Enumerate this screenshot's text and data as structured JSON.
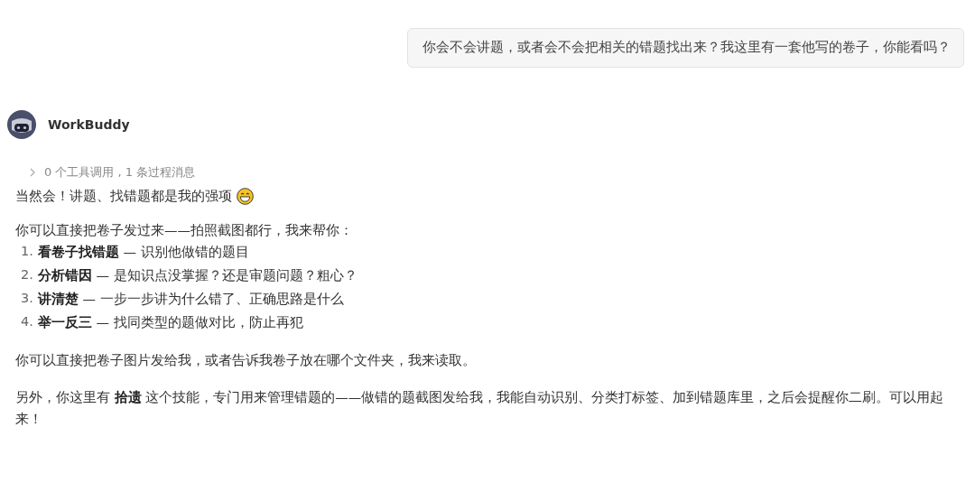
{
  "user_message": "你会不会讲题，或者会不会把相关的错题找出来？我这里有一套他写的卷子，你能看吗？",
  "assistant": {
    "name": "WorkBuddy",
    "process_summary": "0 个工具调用 , 1 条过程消息",
    "expanded": false,
    "intro": "当然会！讲题、找错题都是我的强项",
    "lead": "你可以直接把卷子发过来——拍照截图都行，我来帮你：",
    "steps": [
      {
        "number": "1.",
        "text": "**看卷子找错题** — 识别他做错的题目"
      },
      {
        "number": "2.",
        "text": "**分析错因** — 是知识点没掌握？还是审题问题？粗心？"
      },
      {
        "number": "3.",
        "text": "**讲清楚** — 一步一步讲为什么错了、正确思路是什么"
      },
      {
        "number": "4.",
        "text": "**举一反三** — 找同类型的题做对比，防止再犯"
      }
    ],
    "paragraphs": [
      "你可以直接把卷子图片发给我，或者告诉我卷子放在哪个文件夹，我来读取。",
      "另外，你这里有 **拾遗** 这个技能，专门用来管理错题的——做错的题截图发给我，我能自动识别、分类打标签、加到错题库里，之后会提醒你二刷。可以用起来！"
    ]
  }
}
